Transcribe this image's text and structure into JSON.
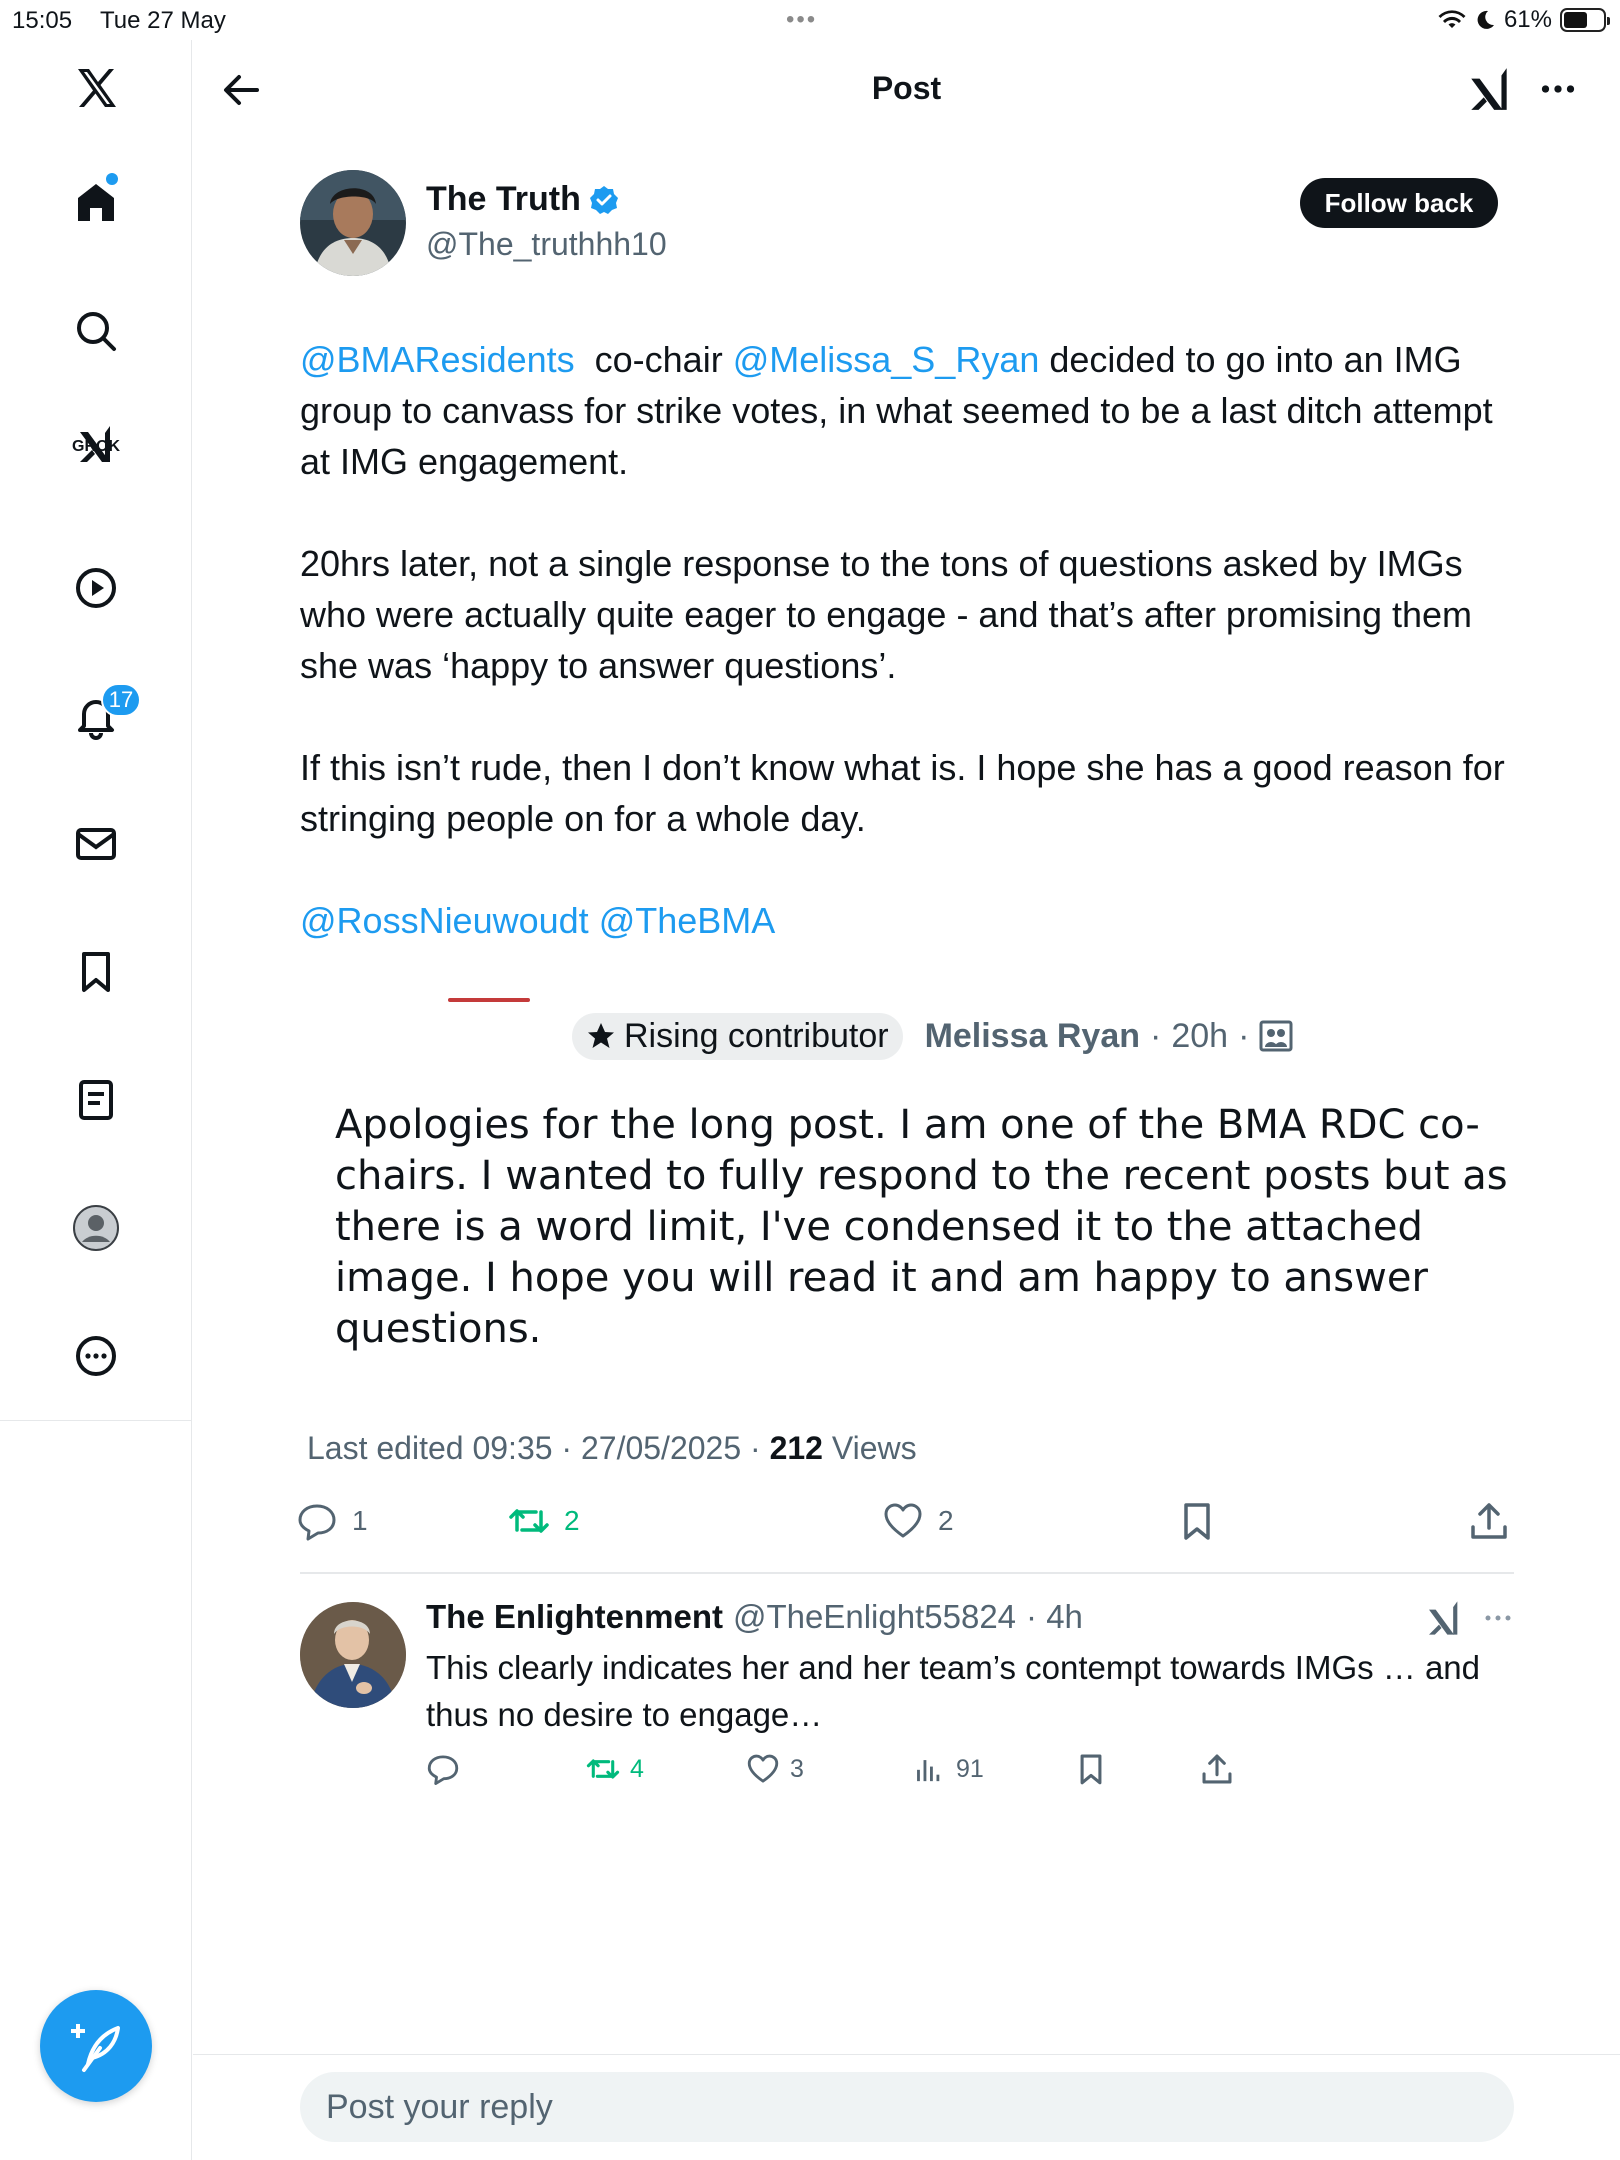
{
  "status_bar": {
    "time": "15:05",
    "date": "Tue 27 May",
    "battery": "61%",
    "battery_level": 0.61
  },
  "sidebar": {
    "grok_label": "GROK",
    "notifications_count": "17",
    "items": [
      "x-logo",
      "home",
      "search",
      "grok",
      "video",
      "notifications",
      "messages",
      "bookmarks",
      "lists",
      "profile",
      "more"
    ]
  },
  "header": {
    "title": "Post"
  },
  "post": {
    "author_name": "The Truth",
    "author_handle": "@The_truthhh10",
    "follow_label": "Follow back",
    "para1": {
      "mention1": "@BMAResidents",
      "text1": "  co-chair ",
      "mention2": "@Melissa_S_Ryan",
      "text2": " decided to go into an IMG group to canvass for strike votes, in what seemed to be a last ditch attempt at IMG engagement."
    },
    "para2": "20hrs later, not a single response to the tons of questions asked by IMGs who were actually quite eager to engage - and that’s after promising them she was ‘happy to answer questions’.",
    "para3": "If this isn’t rude, then I don’t know what is. I hope she has a good reason for stringing people on for a whole day.",
    "para4": {
      "mention1": "@RossNieuwoudt",
      "mention2": "@TheBMA"
    },
    "quote": {
      "badge": "Rising contributor",
      "name": "Melissa Ryan",
      "sep": "·",
      "time": "20h",
      "text": "Apologies for the long post. I am one of the BMA RDC co-chairs. I wanted to fully respond to the recent posts but as there is a word limit, I've condensed it to the attached image. I hope you will read it and am happy to answer questions."
    },
    "edited": "Last edited 09:35 · 27/05/2025",
    "views_sep": " · ",
    "views_count": "212",
    "views_label": " Views",
    "stats": {
      "replies": "1",
      "reposts": "2",
      "likes": "2"
    }
  },
  "reply": {
    "name": "The Enlightenment",
    "handle": "@TheEnlight55824",
    "time": "· 4h",
    "text": "This clearly indicates her and her team’s contempt towards IMGs … and thus no desire to engage…",
    "stats": {
      "reposts": "4",
      "likes": "3",
      "views": "91"
    }
  },
  "composer": {
    "placeholder": "Post your reply"
  },
  "colors": {
    "accent": "#1d9bf0",
    "repost": "#00ba7c",
    "text": "#0f1419",
    "muted": "#536471"
  }
}
